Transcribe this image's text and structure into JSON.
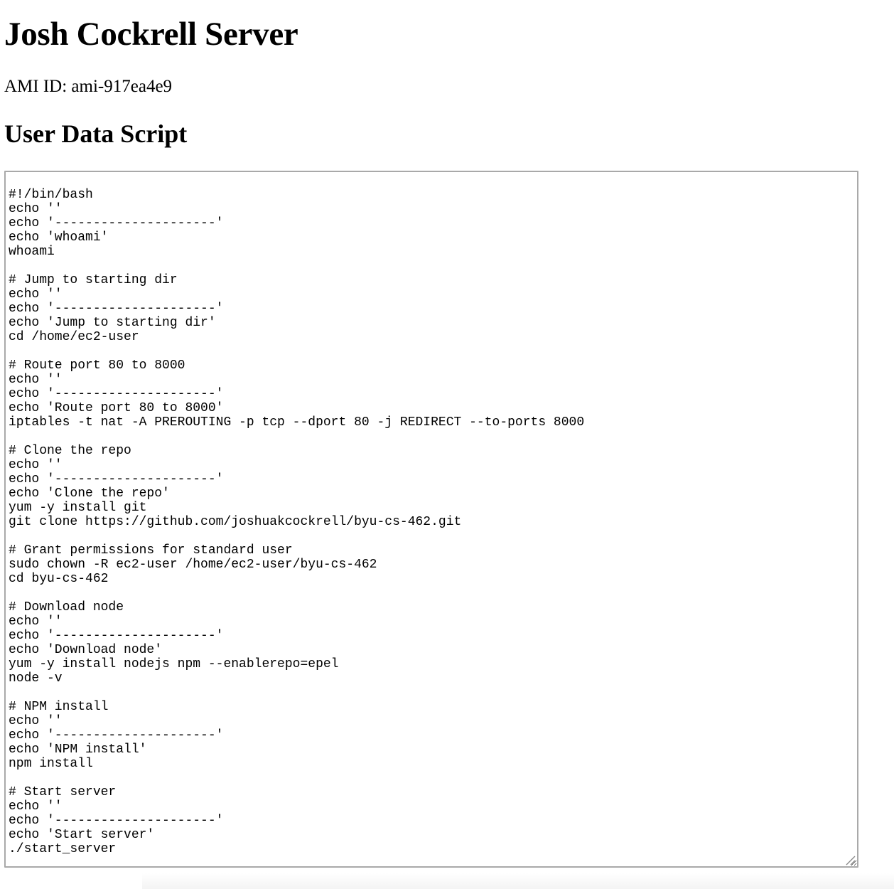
{
  "page": {
    "title": "Josh Cockrell Server",
    "ami_line": "AMI ID: ami-917ea4e9",
    "section_title": "User Data Script"
  },
  "script": {
    "content": "#!/bin/bash\necho ''\necho '---------------------'\necho 'whoami'\nwhoami\n\n# Jump to starting dir\necho ''\necho '---------------------'\necho 'Jump to starting dir'\ncd /home/ec2-user\n\n# Route port 80 to 8000\necho ''\necho '---------------------'\necho 'Route port 80 to 8000'\niptables -t nat -A PREROUTING -p tcp --dport 80 -j REDIRECT --to-ports 8000\n\n# Clone the repo\necho ''\necho '---------------------'\necho 'Clone the repo'\nyum -y install git\ngit clone https://github.com/joshuakcockrell/byu-cs-462.git\n\n# Grant permissions for standard user\nsudo chown -R ec2-user /home/ec2-user/byu-cs-462\ncd byu-cs-462\n\n# Download node\necho ''\necho '---------------------'\necho 'Download node'\nyum -y install nodejs npm --enablerepo=epel\nnode -v\n\n# NPM install\necho ''\necho '---------------------'\necho 'NPM install'\nnpm install\n\n# Start server\necho ''\necho '---------------------'\necho 'Start server'\n./start_server"
  },
  "colors": {
    "text": "#000000",
    "background": "#ffffff",
    "textarea_border": "#a9a9a9"
  },
  "icons": {
    "resize": "resize-grip-icon"
  }
}
